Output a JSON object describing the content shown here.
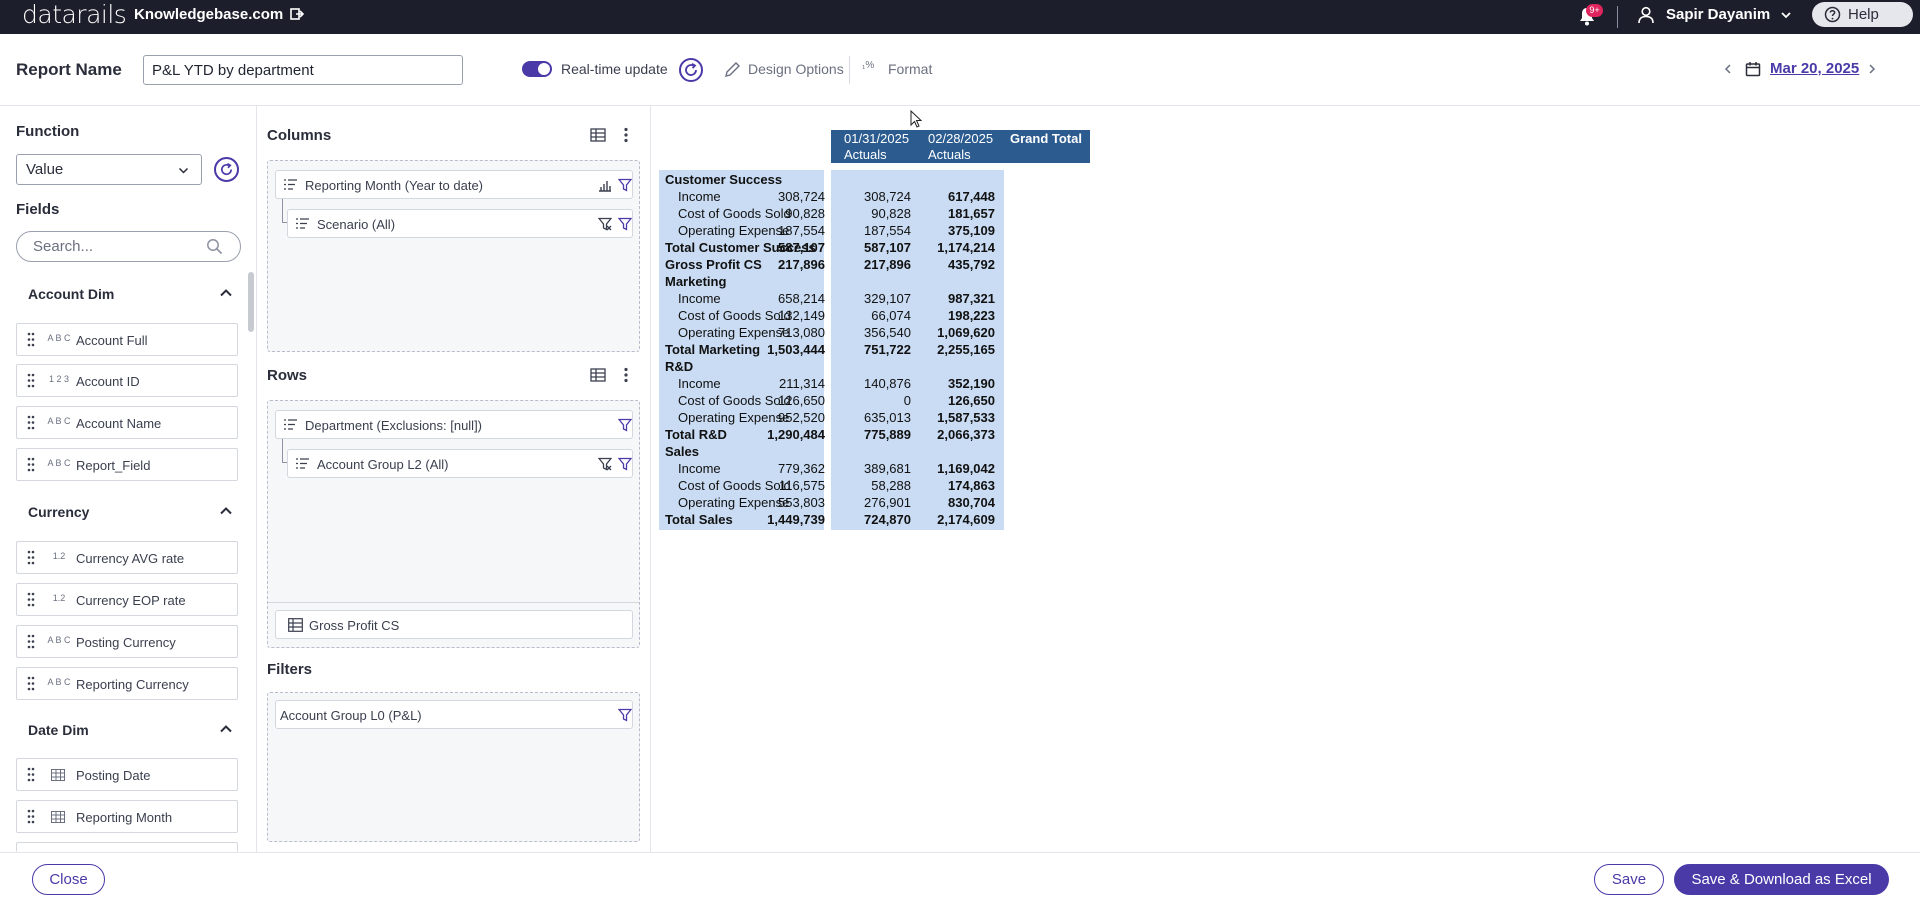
{
  "topbar": {
    "logo": "datarails",
    "workspace": "Knowledgebase.com",
    "notifications_badge": "9+",
    "user_name": "Sapir Dayanim",
    "help_label": "Help"
  },
  "header": {
    "report_name_label": "Report Name",
    "report_name_value": "P&L YTD by department",
    "realtime_label": "Real-time update",
    "realtime_on": true,
    "design_options_label": "Design Options",
    "format_label": "Format",
    "date": "Mar 20, 2025"
  },
  "left_panel": {
    "function_label": "Function",
    "function_value": "Value",
    "fields_label": "Fields",
    "search_placeholder": "Search...",
    "groups": [
      {
        "name": "Account Dim",
        "fields": [
          {
            "name": "Account Full",
            "type": "text"
          },
          {
            "name": "Account ID",
            "type": "number"
          },
          {
            "name": "Account Name",
            "type": "text"
          },
          {
            "name": "Report_Field",
            "type": "text"
          }
        ]
      },
      {
        "name": "Currency",
        "fields": [
          {
            "name": "Currency AVG rate",
            "type": "decimal"
          },
          {
            "name": "Currency EOP rate",
            "type": "decimal"
          },
          {
            "name": "Posting Currency",
            "type": "text"
          },
          {
            "name": "Reporting Currency",
            "type": "text"
          }
        ]
      },
      {
        "name": "Date Dim",
        "fields": [
          {
            "name": "Posting Date",
            "type": "date"
          },
          {
            "name": "Reporting Month",
            "type": "date"
          }
        ]
      }
    ],
    "type_glyphs": {
      "text": "A B C",
      "number": "1 2 3",
      "decimal": "1.2"
    }
  },
  "middle_panel": {
    "columns_label": "Columns",
    "columns": [
      "Reporting Month (Year to date)",
      "Scenario (All)"
    ],
    "rows_label": "Rows",
    "rows": [
      "Department (Exclusions: [null])",
      "Account Group L2 (All)"
    ],
    "rows_value_chip": "Gross Profit CS",
    "filters_label": "Filters",
    "filters": [
      "Account Group L0 (P&L)"
    ]
  },
  "pivot": {
    "headers": [
      {
        "line1": "01/31/2025",
        "line2": "Actuals"
      },
      {
        "line1": "02/28/2025",
        "line2": "Actuals"
      },
      {
        "line1": "Grand Total",
        "line2": ""
      }
    ],
    "rows": [
      {
        "label": "Customer Success",
        "kind": "group",
        "v1": "",
        "v2": "",
        "v3": ""
      },
      {
        "label": "Income",
        "kind": "sub",
        "v1": "308,724",
        "v2": "308,724",
        "v3": "617,448"
      },
      {
        "label": "Cost of Goods Sold",
        "kind": "sub",
        "v1": "90,828",
        "v2": "90,828",
        "v3": "181,657"
      },
      {
        "label": "Operating Expense",
        "kind": "sub",
        "v1": "187,554",
        "v2": "187,554",
        "v3": "375,109"
      },
      {
        "label": "Total Customer Success",
        "kind": "total",
        "v1": "587,107",
        "v2": "587,107",
        "v3": "1,174,214"
      },
      {
        "label": "Gross Profit CS",
        "kind": "total",
        "v1": "217,896",
        "v2": "217,896",
        "v3": "435,792"
      },
      {
        "label": "Marketing",
        "kind": "group",
        "v1": "",
        "v2": "",
        "v3": ""
      },
      {
        "label": "Income",
        "kind": "sub",
        "v1": "658,214",
        "v2": "329,107",
        "v3": "987,321"
      },
      {
        "label": "Cost of Goods Sold",
        "kind": "sub",
        "v1": "132,149",
        "v2": "66,074",
        "v3": "198,223"
      },
      {
        "label": "Operating Expense",
        "kind": "sub",
        "v1": "713,080",
        "v2": "356,540",
        "v3": "1,069,620"
      },
      {
        "label": "Total Marketing",
        "kind": "total",
        "v1": "1,503,444",
        "v2": "751,722",
        "v3": "2,255,165"
      },
      {
        "label": "R&D",
        "kind": "group",
        "v1": "",
        "v2": "",
        "v3": ""
      },
      {
        "label": "Income",
        "kind": "sub",
        "v1": "211,314",
        "v2": "140,876",
        "v3": "352,190"
      },
      {
        "label": "Cost of Goods Sold",
        "kind": "sub",
        "v1": "126,650",
        "v2": "0",
        "v3": "126,650"
      },
      {
        "label": "Operating Expense",
        "kind": "sub",
        "v1": "952,520",
        "v2": "635,013",
        "v3": "1,587,533"
      },
      {
        "label": "Total R&D",
        "kind": "total",
        "v1": "1,290,484",
        "v2": "775,889",
        "v3": "2,066,373"
      },
      {
        "label": "Sales",
        "kind": "group",
        "v1": "",
        "v2": "",
        "v3": ""
      },
      {
        "label": "Income",
        "kind": "sub",
        "v1": "779,362",
        "v2": "389,681",
        "v3": "1,169,042"
      },
      {
        "label": "Cost of Goods Sold",
        "kind": "sub",
        "v1": "116,575",
        "v2": "58,288",
        "v3": "174,863"
      },
      {
        "label": "Operating Expense",
        "kind": "sub",
        "v1": "553,803",
        "v2": "276,901",
        "v3": "830,704"
      },
      {
        "label": "Total Sales",
        "kind": "total",
        "v1": "1,449,739",
        "v2": "724,870",
        "v3": "2,174,609"
      }
    ]
  },
  "footer": {
    "close_label": "Close",
    "save_label": "Save",
    "save_download_label": "Save & Download as Excel"
  },
  "colors": {
    "accent": "#4a3aa8",
    "topbar": "#1c1f2b",
    "pivot_header": "#2b5b8f",
    "pivot_cell": "#c9dcf3"
  }
}
